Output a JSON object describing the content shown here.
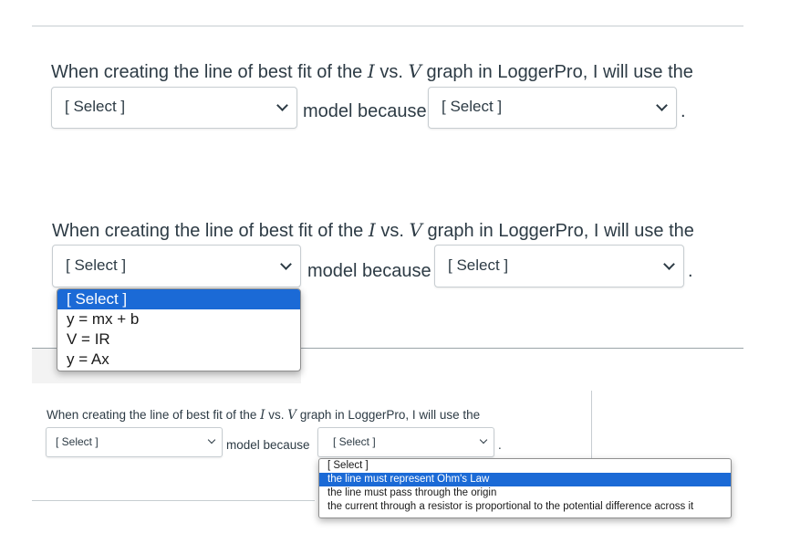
{
  "sentence": {
    "prefix": "When creating the line of best fit of the",
    "var_i": "I",
    "vs": "vs.",
    "var_v": "V",
    "suffix": "graph in LoggerPro, I will use the",
    "middle": "model because",
    "end": "."
  },
  "select1": {
    "value": "[ Select ]"
  },
  "select2": {
    "value": "[ Select ]"
  },
  "model_options": [
    "[ Select ]",
    "y = mx + b",
    "V = IR",
    "y = Ax"
  ],
  "reason_options": [
    "[ Select ]",
    "the line must represent Ohm's Law",
    "the line must pass through the origin",
    "the current through a resistor is proportional to the potential difference across it"
  ],
  "colors": {
    "highlight": "#1b6ad6",
    "text": "#2d3b45",
    "border": "#c7cdd1"
  }
}
